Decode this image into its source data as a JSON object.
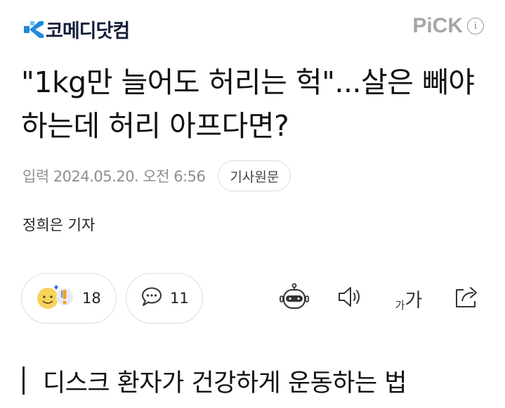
{
  "header": {
    "logo_text": "코메디닷컴",
    "logo_accent_color": "#1f8bd8",
    "pick_label": "PiCK",
    "info_icon": "i"
  },
  "article": {
    "headline": "\"1kg만 늘어도 허리는 헉\"...살은 빼야 하는데 허리 아프다면?",
    "date": "입력 2024.05.20. 오전 6:56",
    "source_button": "기사원문",
    "reporter": "정희은 기자"
  },
  "actions": {
    "reaction_count": "18",
    "comment_count": "11",
    "fontsize_small": "가",
    "fontsize_large": "가",
    "icons": [
      "reaction-emoji-icon",
      "comment-icon",
      "robot-summary-icon",
      "speaker-icon",
      "font-size-icon",
      "share-icon"
    ]
  },
  "section": {
    "heading": "디스크 환자가 건강하게 운동하는 법"
  }
}
